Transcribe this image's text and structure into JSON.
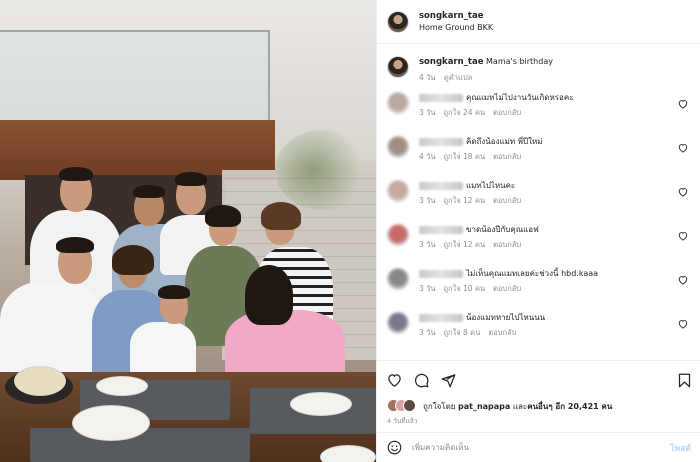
{
  "post": {
    "username": "songkarn_tae",
    "location": "Home Ground BKK",
    "caption": "Mama's birthday",
    "caption_age": "4 วัน",
    "translate": "ดูคำแปล"
  },
  "comments": [
    {
      "text": "คุณแมทไม่ไปงานวันเกิดหรอคะ",
      "age": "3 วัน",
      "likes": "ถูกใจ 24 คน",
      "reply": "ตอบกลับ",
      "avatar_color": "#b9a79c"
    },
    {
      "text": "คิดถึงน้องแม่ท พี่ปีใหม่",
      "age": "4 วัน",
      "likes": "ถูกใจ 18 คน",
      "reply": "ตอบกลับ",
      "avatar_color": "#9d8f84"
    },
    {
      "text": "แมทไปไหนคะ",
      "age": "3 วัน",
      "likes": "ถูกใจ 12 คน",
      "reply": "ตอบกลับ",
      "avatar_color": "#c8a89a"
    },
    {
      "text": "ขาดน้องปีกับคุณแอฟ",
      "age": "3 วัน",
      "likes": "ถูกใจ 12 คน",
      "reply": "ตอบกลับ",
      "avatar_color": "#c96a6a"
    },
    {
      "text": "ไม่เห็นคุณแมทเลยค่ะช่วงนี้ hbd.kaaa",
      "age": "3 วัน",
      "likes": "ถูกใจ 10 คน",
      "reply": "ตอบกลับ",
      "avatar_color": "#8c8783"
    },
    {
      "text": "น้องแมทหายไปไหนนน",
      "age": "3 วัน",
      "likes": "ถูกใจ 8 คน",
      "reply": "ตอบกลับ",
      "avatar_color": "#7e7490"
    }
  ],
  "likes": {
    "prefix": "ถูกใจโดย",
    "user": "pat_napapa",
    "middle": "และ",
    "others": "คนอื่นๆ อีก 20,421 คน"
  },
  "date": "4 วันที่แล้ว",
  "add_comment": {
    "placeholder": "เพิ่มความคิดเห็น",
    "post_label": "โพสต์"
  },
  "icons": {
    "heart": "heart-icon",
    "comment": "comment-icon",
    "share": "share-icon",
    "save": "bookmark-icon",
    "emoji": "emoji-icon"
  }
}
